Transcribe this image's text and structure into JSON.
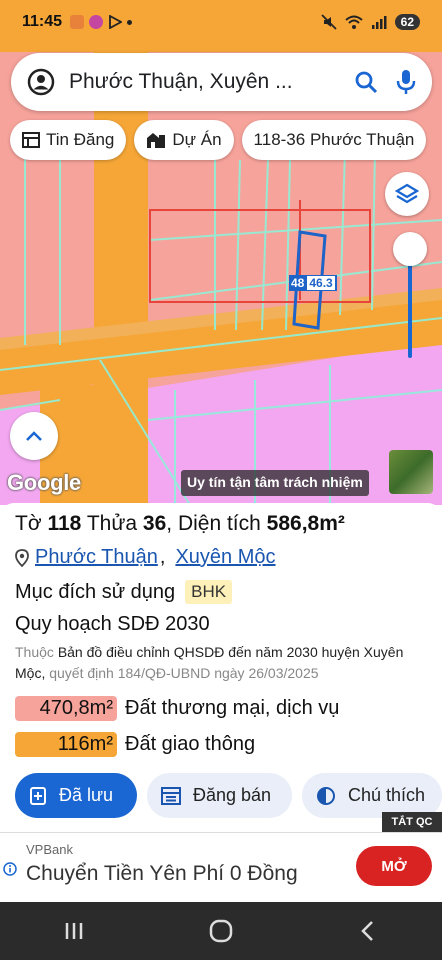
{
  "status_bar": {
    "time": "11:45",
    "battery": "62"
  },
  "search": {
    "query": "Phước Thuận, Xuyên ..."
  },
  "chips": [
    {
      "label": "Tin Đăng",
      "icon": "newspaper-icon"
    },
    {
      "label": "Dự Án",
      "icon": "building-icon"
    },
    {
      "label": "118-36 Phước Thuận",
      "icon": ""
    }
  ],
  "map": {
    "plot_label_a": "48",
    "plot_label_b": "46.3",
    "google_logo": "Google",
    "slogan": "Uy tín tận tâm trách nhiệm",
    "colors": {
      "residential": "#f6a39b",
      "commercial": "#f2a7f0",
      "road": "#f5a637",
      "plot_outline": "#1e63c8"
    }
  },
  "plot": {
    "sheet_prefix": "Tờ",
    "sheet": "118",
    "lot_prefix": "Thửa",
    "lot": "36",
    "area_prefix": "Diện tích",
    "area": "586,8m²",
    "ward": "Phước Thuận",
    "separator": ",",
    "district": "Xuyên Mộc",
    "purpose_label": "Mục đích sử dụng",
    "purpose_code": "BHK",
    "plan_label": "Quy hoạch SDĐ 2030",
    "desc_prefix": "Thuộc",
    "desc_main": "Bản đồ điều chỉnh QHSDĐ đến năm 2030 huyện Xuyên Mộc,",
    "desc_suffix": "quyết định 184/QĐ-UBND ngày 26/03/2025",
    "land_uses": [
      {
        "area": "470,8m²",
        "label": "Đất thương mại, dịch vụ",
        "color": "#f6a39b"
      },
      {
        "area": "116m²",
        "label": "Đất giao thông",
        "color": "#f5a637"
      }
    ]
  },
  "actions": [
    {
      "label": "Đã lưu",
      "icon": "bookmark-add-icon"
    },
    {
      "label": "Đăng bán",
      "icon": "listing-icon"
    },
    {
      "label": "Chú thích",
      "icon": "contrast-icon"
    }
  ],
  "ad": {
    "close_label": "TẮT QC",
    "brand": "VPBank",
    "text": "Chuyển Tiền Yên Phí 0 Đồng",
    "cta": "MỞ"
  }
}
